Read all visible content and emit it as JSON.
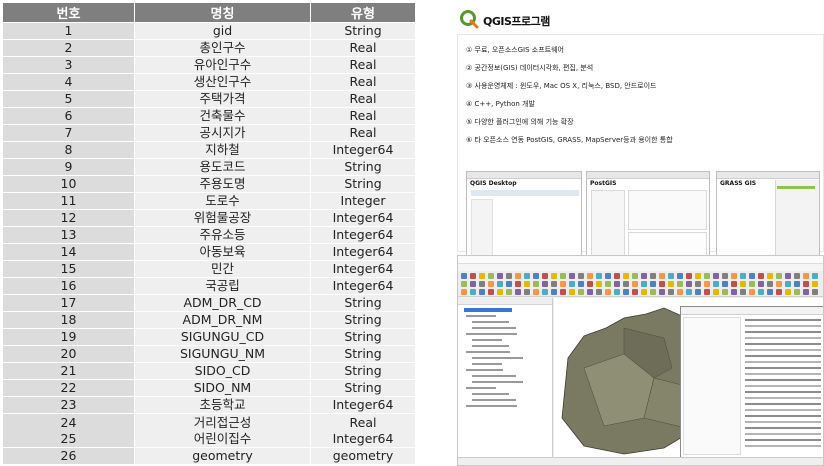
{
  "table": {
    "headers": {
      "no": "번호",
      "name": "명칭",
      "type": "유형"
    },
    "rows": [
      {
        "no": "1",
        "name": "gid",
        "type": "String"
      },
      {
        "no": "2",
        "name": "총인구수",
        "type": "Real"
      },
      {
        "no": "3",
        "name": "유아인구수",
        "type": "Real"
      },
      {
        "no": "4",
        "name": "생산인구수",
        "type": "Real"
      },
      {
        "no": "5",
        "name": "주택가격",
        "type": "Real"
      },
      {
        "no": "6",
        "name": "건축물수",
        "type": "Real"
      },
      {
        "no": "7",
        "name": "공시지가",
        "type": "Real"
      },
      {
        "no": "8",
        "name": "지하철",
        "type": "Integer64"
      },
      {
        "no": "9",
        "name": "용도코드",
        "type": "String"
      },
      {
        "no": "10",
        "name": "주용도명",
        "type": "String"
      },
      {
        "no": "11",
        "name": "도로수",
        "type": "Integer"
      },
      {
        "no": "12",
        "name": "위험물공장",
        "type": "Integer64"
      },
      {
        "no": "13",
        "name": "주유소등",
        "type": "Integer64"
      },
      {
        "no": "14",
        "name": "아동보육",
        "type": "Integer64"
      },
      {
        "no": "15",
        "name": "민간",
        "type": "Integer64"
      },
      {
        "no": "16",
        "name": "국공립",
        "type": "Integer64"
      },
      {
        "no": "17",
        "name": "ADM_DR_CD",
        "type": "String"
      },
      {
        "no": "18",
        "name": "ADM_DR_NM",
        "type": "String"
      },
      {
        "no": "19",
        "name": "SIGUNGU_CD",
        "type": "String"
      },
      {
        "no": "20",
        "name": "SIGUNGU_NM",
        "type": "String"
      },
      {
        "no": "21",
        "name": "SIDO_CD",
        "type": "String"
      },
      {
        "no": "22",
        "name": "SIDO_NM",
        "type": "String"
      },
      {
        "no": "23",
        "name": "초등학교",
        "type": "Integer64"
      }
    ],
    "pair": {
      "no_a": "24",
      "no_b": "25",
      "name_a": "거리접근성",
      "name_b": "어린이집수",
      "type_a": "Real",
      "type_b": "Integer64"
    },
    "last": {
      "no": "26",
      "name": "geometry",
      "type": "geometry"
    }
  },
  "card": {
    "title": "QGIS프로그램",
    "logo_icon": "qgis-logo-icon",
    "features": [
      "① 무료, 오픈소스GIS 소프트웨어",
      "② 공간정보(GIS) 데이터시각화, 편집, 분석",
      "③ 사용운영체제 : 윈도우, Mac OS X, 리눅스, BSD, 안드로이드",
      "④ C++, Python 개발",
      "⑤ 다양한 플러그인에 의해 기능 확장",
      "⑥ 타 오픈소스 연동 PostGIS, GRASS, MapServer등과 용이한 통합"
    ],
    "thumbs": [
      {
        "title": "QGIS Desktop"
      },
      {
        "title": "PostGIS"
      },
      {
        "title": "GRASS GIS"
      }
    ]
  },
  "colors": {
    "header_bg": "#7f7f7f",
    "no_cell_bg": "#dcdcdc",
    "cell_bg": "#efefef",
    "logo_green": "#589632",
    "logo_yellow": "#ee7913"
  }
}
